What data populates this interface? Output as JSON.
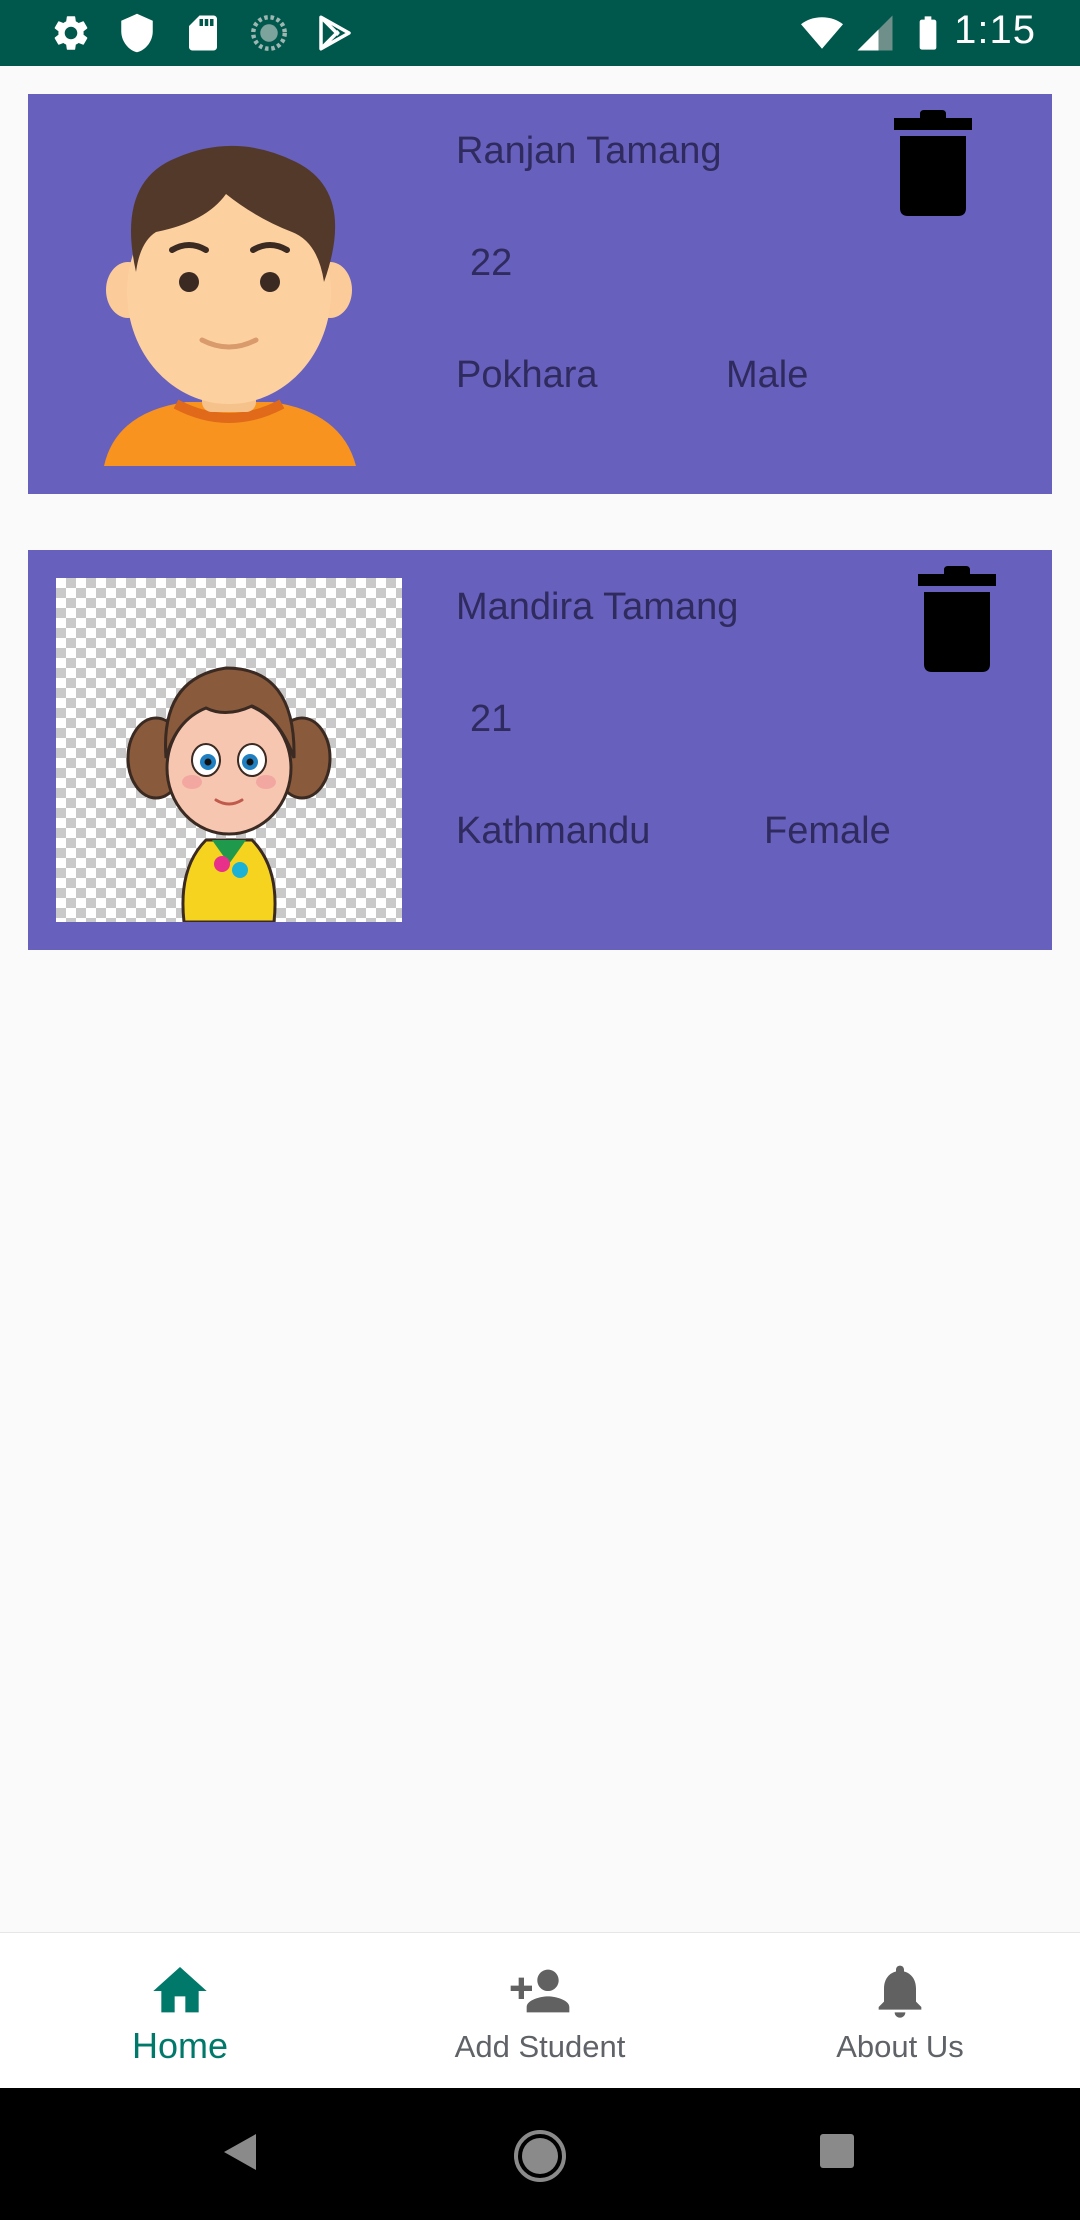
{
  "status_bar": {
    "time": "1:15",
    "left_icons": [
      "gear-icon",
      "shield-icon",
      "sd-card-icon",
      "sync-icon",
      "play-store-icon"
    ],
    "right_icons": [
      "wifi-icon",
      "signal-icon",
      "battery-icon"
    ]
  },
  "students": [
    {
      "name": "Ranjan Tamang",
      "age": "22",
      "address": "Pokhara",
      "gender": "Male",
      "avatar": "boy-avatar-icon"
    },
    {
      "name": "Mandira Tamang",
      "age": "21",
      "address": "Kathmandu",
      "gender": "Female",
      "avatar": "girl-avatar-icon"
    }
  ],
  "bottom_nav": {
    "items": [
      {
        "label": "Home",
        "icon": "home-icon",
        "active": true
      },
      {
        "label": "Add Student",
        "icon": "add-person-icon",
        "active": false
      },
      {
        "label": "About Us",
        "icon": "bell-icon",
        "active": false
      }
    ]
  },
  "colors": {
    "status_bar": "#00574b",
    "card_background": "#6760bd",
    "card_text": "#2f2b5e",
    "nav_active": "#00796b",
    "nav_inactive": "#5f6368"
  }
}
